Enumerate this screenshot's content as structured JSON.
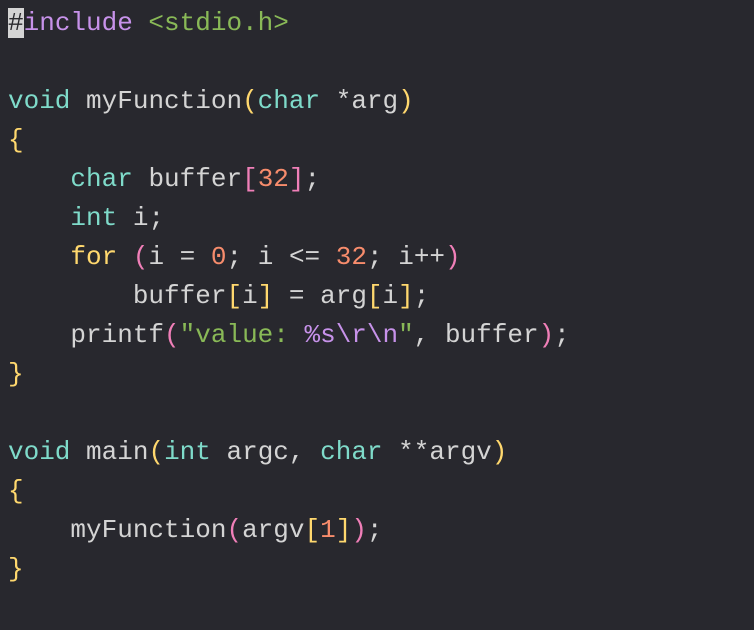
{
  "code": {
    "line1": {
      "hash": "#",
      "include": "include",
      "open": " <",
      "header": "stdio.h",
      "close": ">"
    },
    "line3": {
      "ret": "void",
      "space1": " ",
      "fname": "myFunction",
      "lparen": "(",
      "ptype": "char",
      "space2": " ",
      "star": "*",
      "pname": "arg",
      "rparen": ")"
    },
    "line4": {
      "brace": "{"
    },
    "line5": {
      "indent": "    ",
      "type": "char",
      "space": " ",
      "var": "buffer",
      "lbrack": "[",
      "num": "32",
      "rbrack": "]",
      "semi": ";"
    },
    "line6": {
      "indent": "    ",
      "type": "int",
      "space": " ",
      "var": "i",
      "semi": ";"
    },
    "line7": {
      "indent": "    ",
      "for": "for",
      "space1": " ",
      "lparen": "(",
      "init_var": "i",
      "space2": " ",
      "eq": "=",
      "space3": " ",
      "zero": "0",
      "semi1": ";",
      "space4": " ",
      "cond_var": "i",
      "space5": " ",
      "cmp": "<=",
      "space6": " ",
      "limit": "32",
      "semi2": ";",
      "space7": " ",
      "inc_var": "i",
      "inc_op": "++",
      "rparen": ")"
    },
    "line8": {
      "indent": "        ",
      "lhs": "buffer",
      "lbrack1": "[",
      "idx1": "i",
      "rbrack1": "]",
      "space1": " ",
      "eq": "=",
      "space2": " ",
      "rhs": "arg",
      "lbrack2": "[",
      "idx2": "i",
      "rbrack2": "]",
      "semi": ";"
    },
    "line9": {
      "indent": "    ",
      "fn": "printf",
      "lparen": "(",
      "str1": "\"value: ",
      "fmt": "%s\\r\\n",
      "str2": "\"",
      "comma": ",",
      "space": " ",
      "arg": "buffer",
      "rparen": ")",
      "semi": ";"
    },
    "line10": {
      "brace": "}"
    },
    "line12": {
      "ret": "void",
      "space1": " ",
      "fname": "main",
      "lparen": "(",
      "p1type": "int",
      "space2": " ",
      "p1name": "argc",
      "comma": ",",
      "space3": " ",
      "p2type": "char",
      "space4": " ",
      "stars": "**",
      "p2name": "argv",
      "rparen": ")"
    },
    "line13": {
      "brace": "{"
    },
    "line14": {
      "indent": "    ",
      "fn": "myFunction",
      "lparen": "(",
      "arg": "argv",
      "lbrack": "[",
      "idx": "1",
      "rbrack": "]",
      "rparen": ")",
      "semi": ";"
    },
    "line15": {
      "brace": "}"
    }
  }
}
